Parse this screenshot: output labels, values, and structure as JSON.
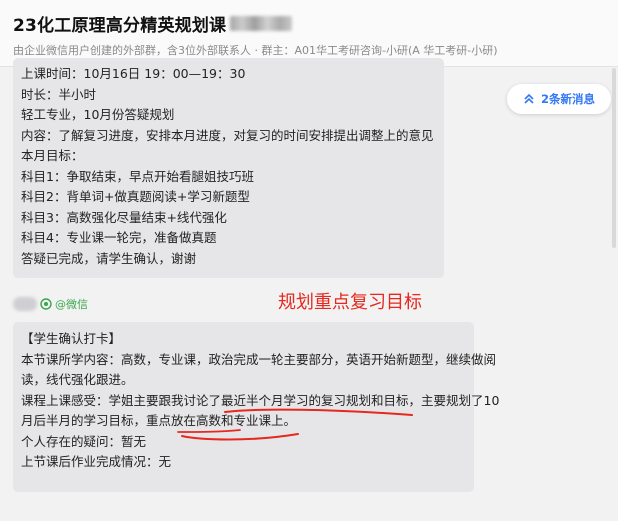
{
  "header": {
    "title": "23化工原理高分精英规划课",
    "subtitle": "由企业微信用户创建的外部群，含3位外部联系人 · 群主：A01华工考研咨询-小研(A 华工考研-小研)"
  },
  "new_messages": {
    "label": "2条新消息",
    "icon": "double-chevron-up-icon"
  },
  "message1": {
    "lines": [
      "上课时间：10月16日 19：00—19：30",
      "时长：半小时",
      "轻工专业，10月份答疑规划",
      "内容：了解复习进度，安排本月进度，对复习的时间安排提出调整上的意见",
      "本月目标：",
      "科目1：争取结束，早点开始看腿姐技巧班",
      "科目2：背单词+做真题阅读+学习新题型",
      "科目3：高数强化尽量结束+线代强化",
      "科目4：专业课一轮完，准备做真题",
      "答疑已完成，请学生确认，谢谢"
    ]
  },
  "sender2": {
    "source_label": "@微信",
    "icon": "wechat-icon"
  },
  "annotation": {
    "text": "规划重点复习目标",
    "color": "#e6281e"
  },
  "message2": {
    "lines": [
      "【学生确认打卡】",
      "本节课所学内容：高数，专业课，政治完成一轮主要部分，英语开始新题型，继续做阅",
      "读，线代强化跟进。",
      "课程上课感受：学姐主要跟我讨论了最近半个月学习的复习规划和目标，主要规划了10",
      "月后半月的学习目标，重点放在高数和专业课上。",
      "个人存在的疑问：暂无",
      "上节课后作业完成情况：无"
    ]
  },
  "colors": {
    "accent": "#3478f6",
    "annotation": "#e6281e",
    "wechat_green": "#3aa74a",
    "bubble": "#e6e6e8"
  }
}
